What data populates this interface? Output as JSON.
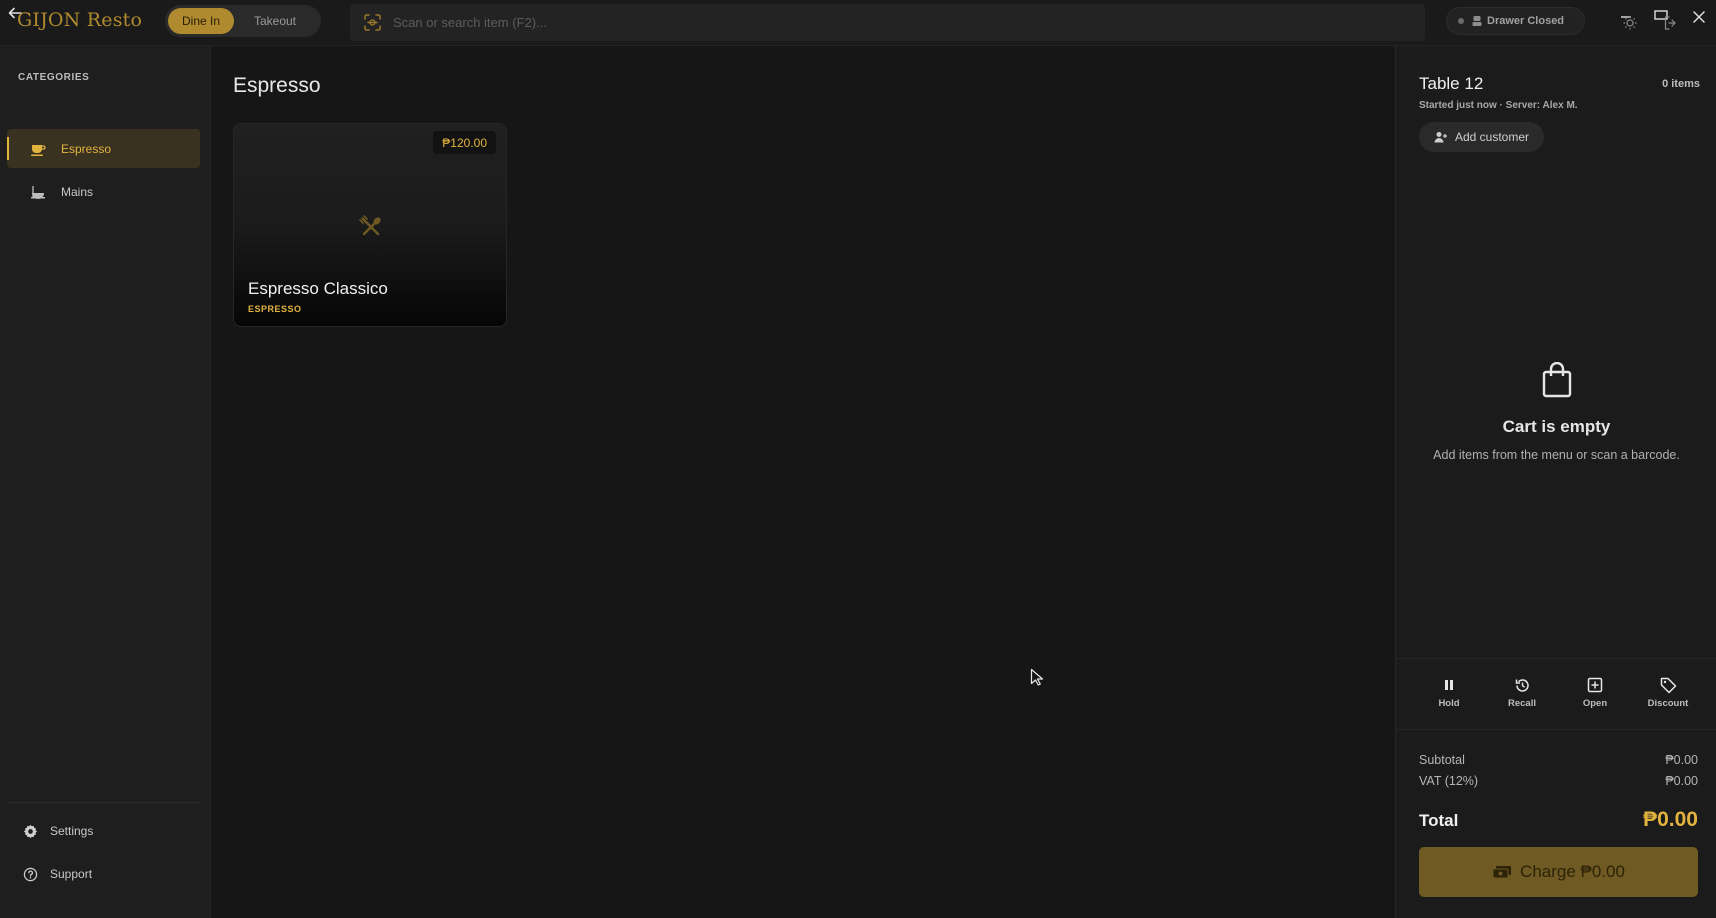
{
  "app": {
    "brand": "GIJON Resto"
  },
  "topbar": {
    "modes": {
      "dine_in": "Dine In",
      "takeout": "Takeout",
      "active": "Dine In"
    },
    "search_placeholder": "Scan or search item (F2)...",
    "drawer_status": "Drawer Closed"
  },
  "sidebar": {
    "heading": "CATEGORIES",
    "categories": [
      {
        "label": "Espresso",
        "icon": "coffee-cup-icon",
        "active": true
      },
      {
        "label": "Mains",
        "icon": "dish-icon",
        "active": false
      }
    ],
    "settings_label": "Settings",
    "support_label": "Support"
  },
  "main": {
    "title": "Espresso",
    "products": [
      {
        "name": "Espresso Classico",
        "category": "ESPRESSO",
        "price": "₱120.00",
        "icon": "utensils-icon"
      }
    ]
  },
  "order": {
    "table": "Table 12",
    "item_count": "0 items",
    "meta": "Started just now · Server: Alex M.",
    "add_customer_label": "Add customer",
    "empty_title": "Cart is empty",
    "empty_subtitle": "Add items from the menu or scan a barcode.",
    "actions": [
      {
        "label": "Hold",
        "icon": "pause-icon"
      },
      {
        "label": "Recall",
        "icon": "history-icon"
      },
      {
        "label": "Open",
        "icon": "plus-square-icon"
      },
      {
        "label": "Discount",
        "icon": "tag-icon"
      }
    ],
    "subtotal_label": "Subtotal",
    "subtotal_value": "₱0.00",
    "vat_label": "VAT (12%)",
    "vat_value": "₱0.00",
    "total_label": "Total",
    "total_value": "₱0.00",
    "charge_label": "Charge ₱0.00"
  },
  "colors": {
    "accent": "#e2b33f",
    "accent_muted": "#b08a2e",
    "charge_bg": "#6e5a22",
    "background": "#161616"
  }
}
